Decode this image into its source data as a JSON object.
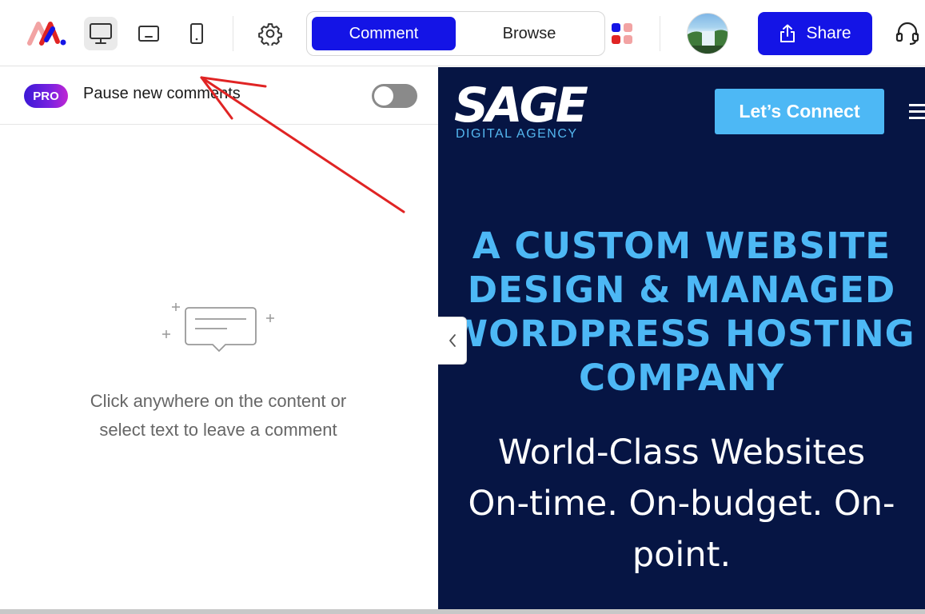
{
  "toolbar": {
    "mode_comment": "Comment",
    "mode_browse": "Browse",
    "share_label": "Share",
    "active_mode": "comment",
    "active_device": "desktop"
  },
  "comments_panel": {
    "pro_badge": "PRO",
    "pause_label": "Pause new comments",
    "pause_enabled": false,
    "empty_state_line1": "Click anywhere on the content or",
    "empty_state_line2": "select text to leave a comment"
  },
  "preview": {
    "logo_word": "SAGE",
    "logo_sub": "DIGITAL AGENCY",
    "cta_label": "Let’s Connect",
    "hero_line1": "A CUSTOM WEBSITE",
    "hero_line2": "DESIGN & MANAGED",
    "hero_line3": "WORDPRESS HOSTING",
    "hero_line4": "COMPANY",
    "sub_line1": "World-Class Websites",
    "sub_line2": "On-time. On-budget. On-",
    "sub_line3": "point."
  },
  "colors": {
    "accent": "#1414e6",
    "preview_bg": "#061544",
    "preview_accent": "#4db8f5",
    "annotation": "#e02424"
  },
  "icons": {
    "logo": "brand-logo-icon",
    "desktop": "desktop-icon",
    "tablet": "tablet-icon",
    "mobile": "mobile-icon",
    "settings": "gear-icon",
    "apps": "apps-grid-icon",
    "share": "share-icon",
    "support": "headset-icon",
    "collapse": "chevron-left-icon",
    "empty_state": "comment-bubble-icon"
  }
}
